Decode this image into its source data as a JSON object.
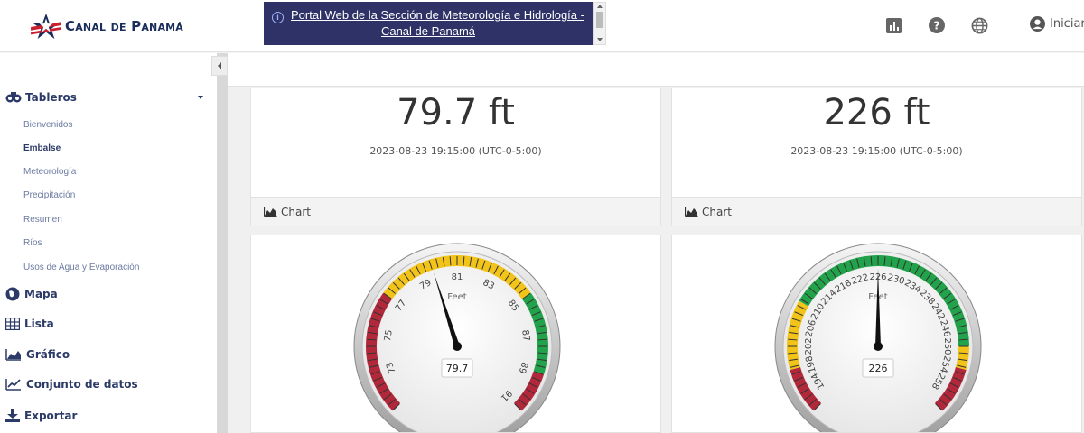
{
  "header": {
    "logo_text": "Canal de Panamá",
    "banner_text": "Portal Web de la Sección de Meteorología e Hidrología - Canal de Panamá",
    "icons": [
      "chart-icon",
      "help-icon",
      "globe-icon"
    ],
    "login_label": "Iniciar"
  },
  "sidebar": {
    "section": {
      "label": "Tableros",
      "items": [
        "Bienvenidos",
        "Embalse",
        "Meteorología",
        "Precipitación",
        "Resumen",
        "Ríos",
        "Usos de Agua y Evaporación"
      ],
      "active_item": "Embalse"
    },
    "items": [
      {
        "label": "Mapa",
        "icon": "map-icon"
      },
      {
        "label": "Lista",
        "icon": "table-icon"
      },
      {
        "label": "Gráfico",
        "icon": "area-chart-icon"
      },
      {
        "label": "Conjunto de datos",
        "icon": "line-chart-icon"
      },
      {
        "label": "Exportar",
        "icon": "download-icon"
      }
    ]
  },
  "cards": [
    {
      "value": "79.7 ft",
      "timestamp": "2023-08-23 19:15:00 (UTC-0-5:00)",
      "footer_label": "Chart"
    },
    {
      "value": "226 ft",
      "timestamp": "2023-08-23 19:15:00 (UTC-0-5:00)",
      "footer_label": "Chart"
    }
  ],
  "gauges": [
    {
      "unit": "Feet",
      "value": 79.7,
      "value_label": "79.7",
      "min": 71,
      "max": 91,
      "tick_labels": [
        "73",
        "75",
        "77",
        "79",
        "81",
        "83",
        "85",
        "87",
        "89",
        "91"
      ],
      "bands": [
        {
          "from": 71,
          "to": 77,
          "color": "#b0283a"
        },
        {
          "from": 77,
          "to": 85,
          "color": "#f2c318"
        },
        {
          "from": 85,
          "to": 89,
          "color": "#22a24a"
        },
        {
          "from": 89,
          "to": 91,
          "color": "#b0283a"
        }
      ]
    },
    {
      "unit": "Feet",
      "value": 226,
      "value_label": "226",
      "min": 190,
      "max": 262,
      "tick_labels": [
        "194",
        "198",
        "202",
        "206",
        "210",
        "214",
        "218",
        "222",
        "226",
        "230",
        "234",
        "238",
        "242",
        "246",
        "250",
        "254",
        "258"
      ],
      "bands": [
        {
          "from": 190,
          "to": 198,
          "color": "#b0283a"
        },
        {
          "from": 198,
          "to": 210,
          "color": "#f2c318"
        },
        {
          "from": 210,
          "to": 250,
          "color": "#22a24a"
        },
        {
          "from": 250,
          "to": 254,
          "color": "#f2c318"
        },
        {
          "from": 254,
          "to": 262,
          "color": "#b0283a"
        }
      ]
    }
  ]
}
